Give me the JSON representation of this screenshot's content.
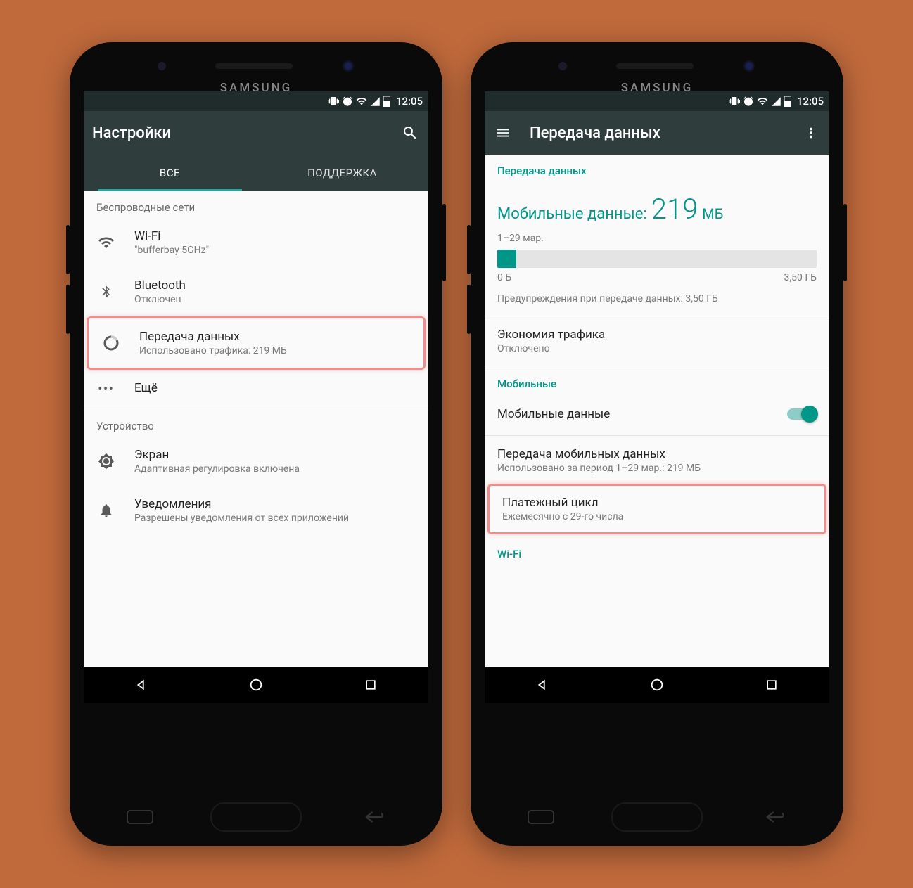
{
  "colors": {
    "accent": "#009688",
    "highlight": "#f38b8b"
  },
  "status": {
    "time": "12:05"
  },
  "phone1": {
    "brand": "SAMSUNG",
    "app_title": "Настройки",
    "tabs": {
      "all": "ВСЕ",
      "support": "ПОДДЕРЖКА"
    },
    "section_wireless": "Беспроводные сети",
    "wifi": {
      "title": "Wi-Fi",
      "subtitle": "\"bufferbay 5GHz\""
    },
    "bluetooth": {
      "title": "Bluetooth",
      "subtitle": "Отключен"
    },
    "data_usage": {
      "title": "Передача данных",
      "subtitle": "Использовано трафика: 219 МБ"
    },
    "more": {
      "title": "Ещё"
    },
    "section_device": "Устройство",
    "display": {
      "title": "Экран",
      "subtitle": "Адаптивная регулировка включена"
    },
    "notifications": {
      "title": "Уведомления",
      "subtitle": "Разрешены уведомления от всех приложений"
    }
  },
  "phone2": {
    "brand": "SAMSUNG",
    "app_title": "Передача данных",
    "section_data": "Передача данных",
    "mobile_data_label": "Мобильные данные:",
    "mobile_data_value": "219",
    "mobile_data_unit": "МБ",
    "date_range": "1–29 мар.",
    "bar_min": "0 Б",
    "bar_max": "3,50 ГБ",
    "warning": "Предупреждения при передаче данных: 3,50 ГБ",
    "data_saver": {
      "title": "Экономия трафика",
      "subtitle": "Отключено"
    },
    "section_mobile": "Мобильные",
    "mobile_toggle": {
      "title": "Мобильные данные"
    },
    "mobile_usage": {
      "title": "Передача мобильных данных",
      "subtitle": "Использовано за период 1–29 мар.: 219 МБ"
    },
    "billing_cycle": {
      "title": "Платежный цикл",
      "subtitle": "Ежемесячно с 29-го числа"
    },
    "section_wifi": "Wi-Fi"
  }
}
